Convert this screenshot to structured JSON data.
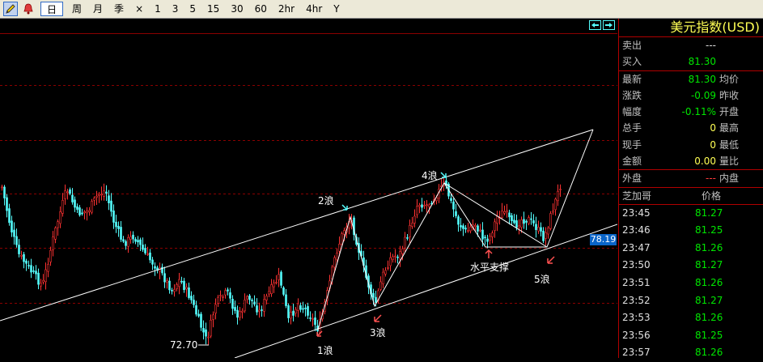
{
  "toolbar": {
    "icons": [
      "draw-pencil-icon",
      "alarm-bell-icon"
    ],
    "periods": [
      "日",
      "周",
      "月",
      "季",
      "×",
      "1",
      "3",
      "5",
      "15",
      "30",
      "60",
      "2hr",
      "4hr",
      "Y"
    ],
    "selected_period": "日"
  },
  "chart": {
    "nav_arrows": [
      "prev-arrow-icon",
      "next-arrow-icon"
    ],
    "price_tag": "78.19",
    "low_label": "72.70",
    "annotations": {
      "wave1": "1浪",
      "wave2": "2浪",
      "wave3": "3浪",
      "wave4": "4浪",
      "wave5": "5浪",
      "support": "水平支撑"
    },
    "colors": {
      "up": "#ff3232",
      "down": "#54fcfc",
      "grid": "#8b0000",
      "line": "#ffffff"
    }
  },
  "panel": {
    "title": "美元指数(USD)",
    "sell_label": "卖出",
    "sell_value": "---",
    "buy_label": "买入",
    "buy_value": "81.30",
    "rows": [
      {
        "label": "最新",
        "value": "81.30",
        "right": "均价",
        "color": "green"
      },
      {
        "label": "涨跌",
        "value": "-0.09",
        "right": "昨收",
        "color": "green"
      },
      {
        "label": "幅度",
        "value": "-0.11%",
        "right": "开盘",
        "color": "green"
      },
      {
        "label": "总手",
        "value": "0",
        "right": "最高",
        "color": "yellow"
      },
      {
        "label": "现手",
        "value": "0",
        "right": "最低",
        "color": "yellow"
      },
      {
        "label": "金额",
        "value": "0.00",
        "right": "量比",
        "color": "yellow"
      },
      {
        "label": "外盘",
        "value": "---",
        "right": "内盘",
        "color": "red"
      }
    ],
    "ticks_header": {
      "left": "芝加哥",
      "right": "价格"
    },
    "ticks": [
      {
        "time": "23:45",
        "price": "81.27"
      },
      {
        "time": "23:46",
        "price": "81.25"
      },
      {
        "time": "23:47",
        "price": "81.26"
      },
      {
        "time": "23:50",
        "price": "81.27"
      },
      {
        "time": "23:51",
        "price": "81.26"
      },
      {
        "time": "23:52",
        "price": "81.27"
      },
      {
        "time": "23:53",
        "price": "81.26"
      },
      {
        "time": "23:56",
        "price": "81.25"
      },
      {
        "time": "23:57",
        "price": "81.26"
      }
    ]
  }
}
